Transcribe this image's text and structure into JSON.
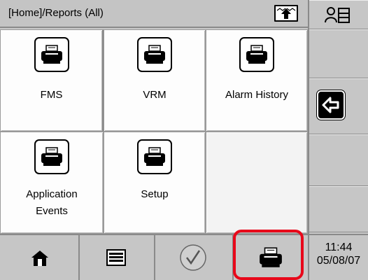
{
  "header": {
    "title": "[Home]/Reports (All)",
    "nav_up_icon": "arrow-up-icon"
  },
  "sidebar": {
    "user_menu_icon": "user-list-icon",
    "back_icon": "back-arrow-icon"
  },
  "tiles": [
    {
      "label": "FMS",
      "icon": "printer-icon",
      "selected": true
    },
    {
      "label": "VRM",
      "icon": "printer-icon"
    },
    {
      "label": "Alarm History",
      "icon": "printer-icon"
    },
    {
      "label_lines": [
        "Application",
        "Events"
      ],
      "icon": "printer-icon"
    },
    {
      "label": "Setup",
      "icon": "printer-icon"
    },
    {
      "label": "",
      "empty": true
    }
  ],
  "toolbar": {
    "buttons": [
      {
        "icon": "home-icon"
      },
      {
        "icon": "list-icon"
      },
      {
        "icon": "check-icon"
      },
      {
        "icon": "printer-icon",
        "highlighted": true
      }
    ]
  },
  "clock": {
    "time": "11:44",
    "date": "05/08/07"
  },
  "colors": {
    "highlight": "#e8081a",
    "background": "#c9c9c9",
    "tile": "#fdfdfd"
  }
}
